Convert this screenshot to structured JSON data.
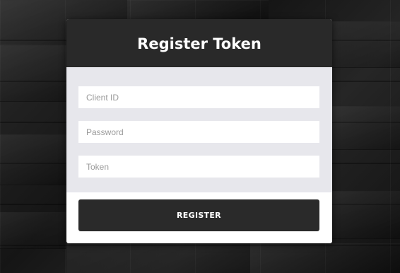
{
  "form": {
    "title": "Register Token",
    "fields": {
      "client_id": {
        "placeholder": "Client ID",
        "value": ""
      },
      "password": {
        "placeholder": "Password",
        "value": ""
      },
      "token": {
        "placeholder": "Token",
        "value": ""
      }
    },
    "submit_label": "REGISTER"
  },
  "colors": {
    "header_background": "#292929",
    "body_background": "#e7e7ec",
    "button_background": "#2a2a2a",
    "page_background": "#1c1c1c"
  }
}
